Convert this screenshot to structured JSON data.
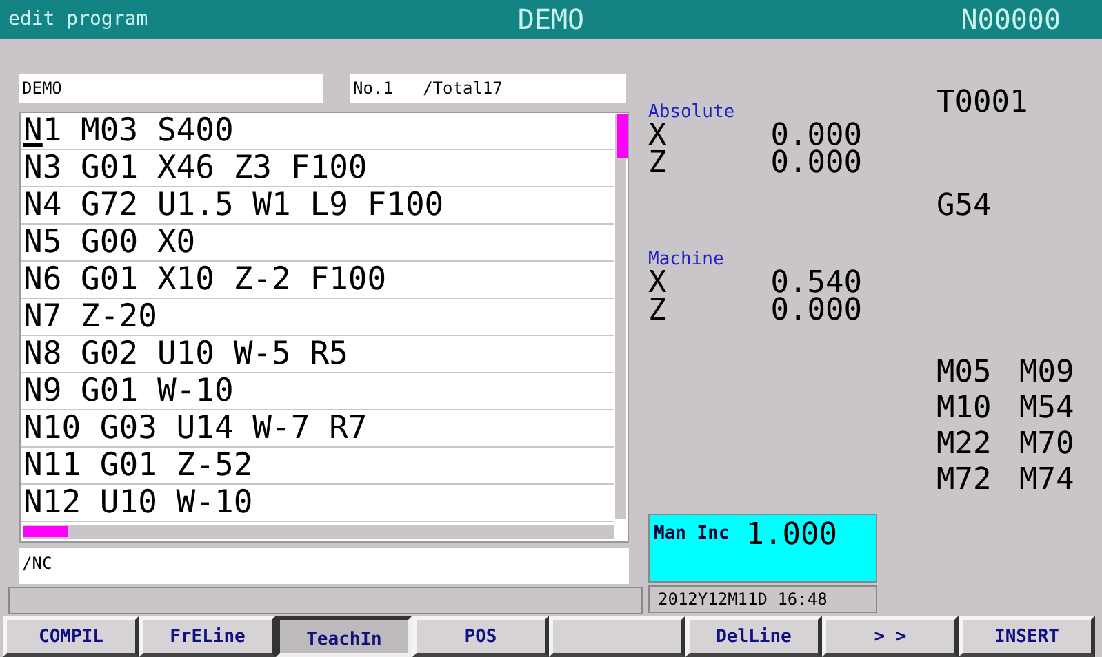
{
  "header": {
    "mode": "edit program",
    "program": "DEMO",
    "block": "N00000"
  },
  "program_name": "DEMO",
  "counter": "No.1   /Total17",
  "lines": [
    {
      "text": "N1 M03 S400",
      "cursor": true
    },
    {
      "text": "N3 G01 X46 Z3 F100",
      "cursor": false
    },
    {
      "text": "N4 G72 U1.5 W1 L9 F100",
      "cursor": false
    },
    {
      "text": "N5 G00 X0",
      "cursor": false
    },
    {
      "text": "N6 G01 X10 Z-2 F100",
      "cursor": false
    },
    {
      "text": "N7 Z-20",
      "cursor": false
    },
    {
      "text": "N8 G02 U10 W-5 R5",
      "cursor": false
    },
    {
      "text": "N9 G01 W-10",
      "cursor": false
    },
    {
      "text": "N10 G03 U14 W-7 R7",
      "cursor": false
    },
    {
      "text": "N11 G01 Z-52",
      "cursor": false
    },
    {
      "text": "N12 U10 W-10",
      "cursor": false
    }
  ],
  "input_line": "/NC",
  "positions": [
    {
      "title": "Absolute",
      "axes": [
        {
          "axis": "X",
          "value": "0.000"
        },
        {
          "axis": "Z",
          "value": "0.000"
        }
      ]
    },
    {
      "title": "Machine",
      "axes": [
        {
          "axis": "X",
          "value": "0.540"
        },
        {
          "axis": "Z",
          "value": "0.000"
        }
      ]
    }
  ],
  "tool": "T0001",
  "work_offset": "G54",
  "m_codes": [
    "M05",
    "M09",
    "M10",
    "M54",
    "M22",
    "M70",
    "M72",
    "M74"
  ],
  "increment": {
    "label": "Man Inc",
    "value": "1.000"
  },
  "datetime": "2012Y12M11D 16:48",
  "softkeys": [
    {
      "label": "COMPIL",
      "selected": false
    },
    {
      "label": "FrELine",
      "selected": false
    },
    {
      "label": "TeachIn",
      "selected": true
    },
    {
      "label": "POS",
      "selected": false
    },
    {
      "selected": false
    },
    {
      "label": "DelLine",
      "selected": false
    },
    {
      "label": "> >",
      "selected": false
    },
    {
      "label": "INSERT",
      "selected": false
    }
  ]
}
